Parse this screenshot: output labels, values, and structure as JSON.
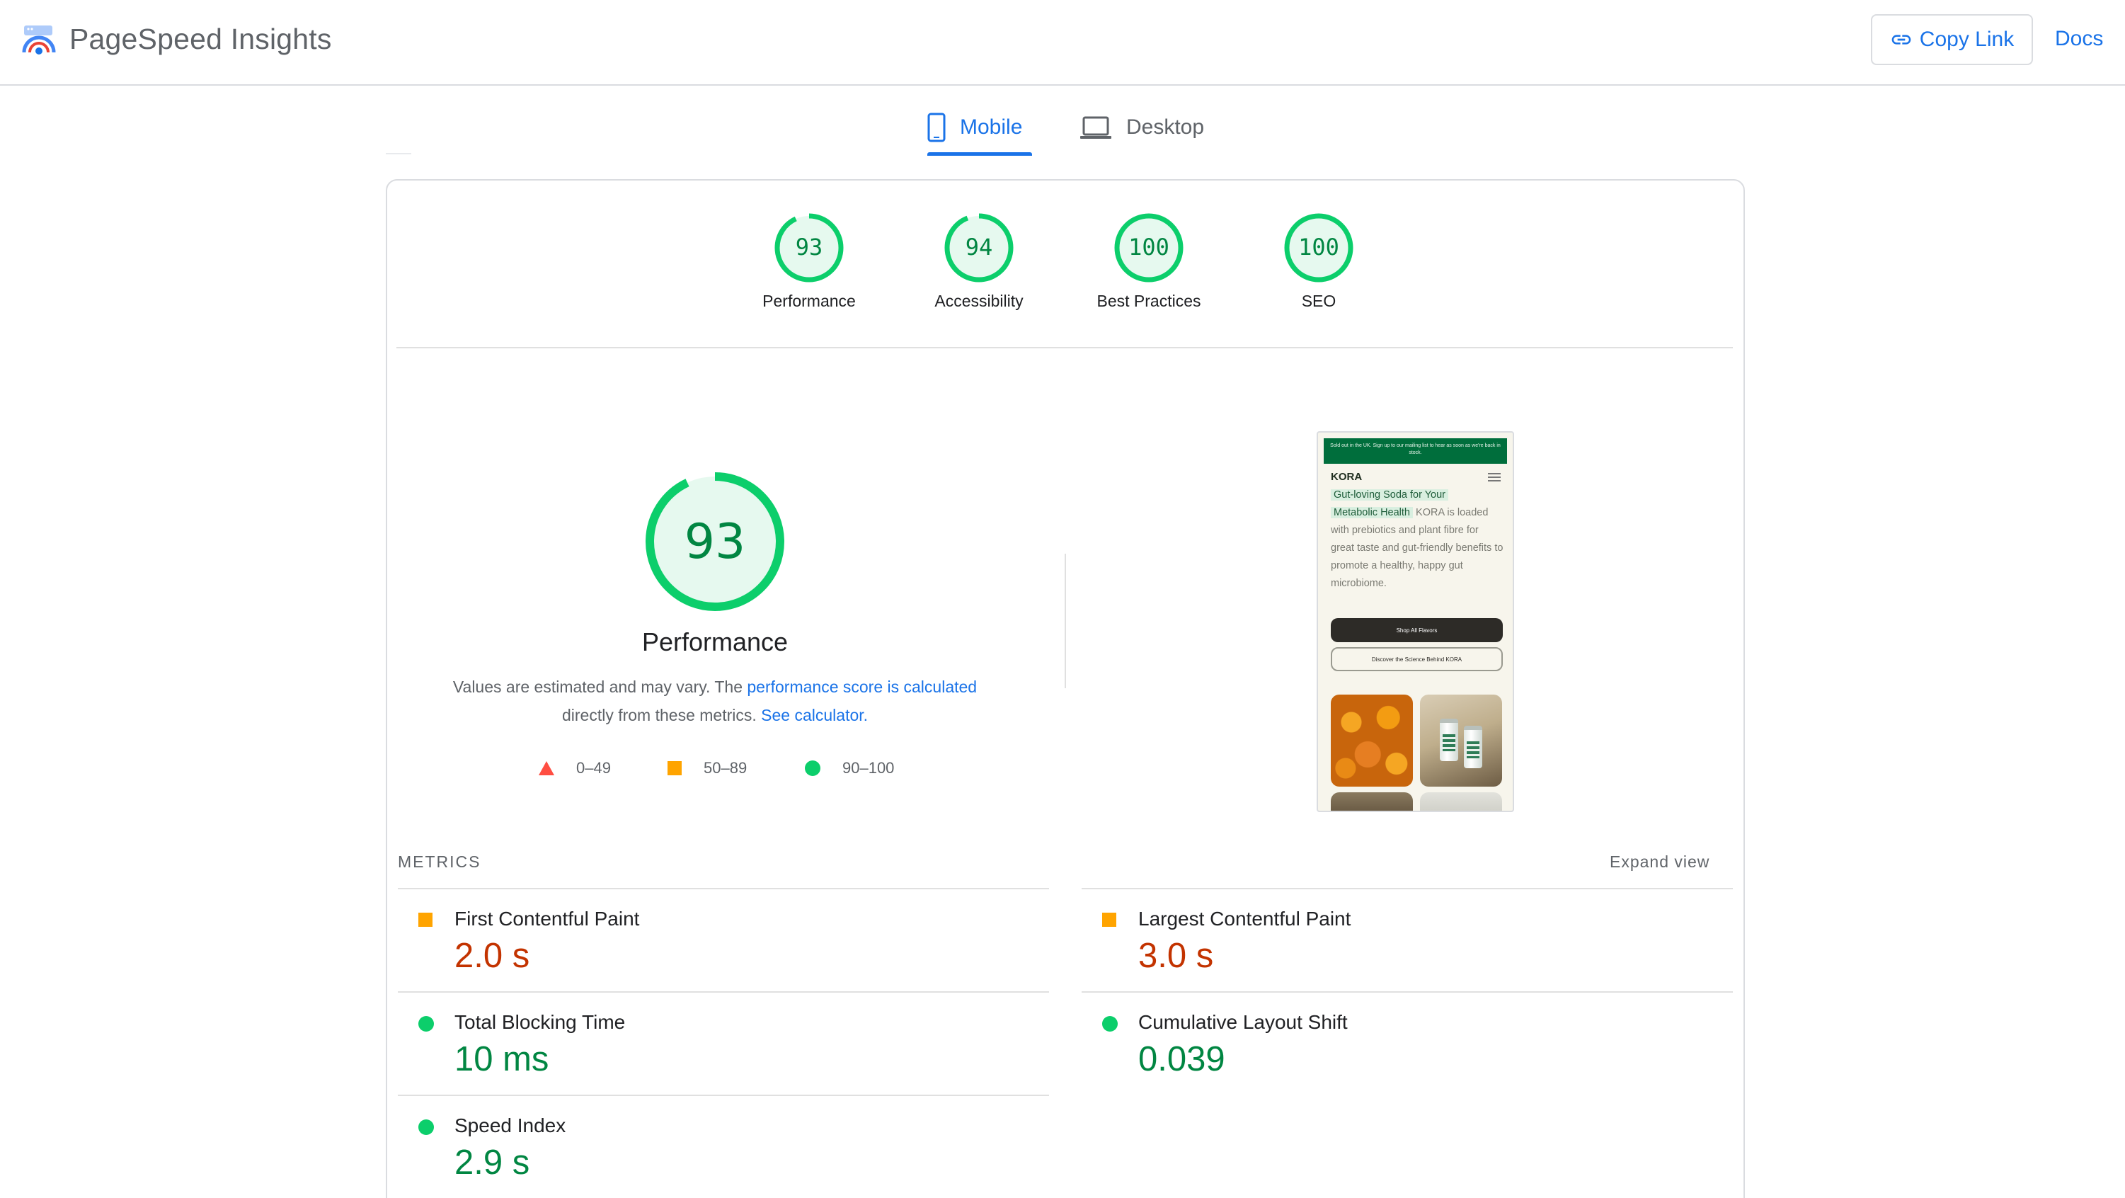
{
  "header": {
    "app_name": "PageSpeed Insights",
    "logo_icon": "pagespeed-logo-icon",
    "copy_link_label": "Copy Link",
    "docs_label": "Docs"
  },
  "tabs": [
    {
      "label": "Mobile",
      "icon": "phone-icon",
      "selected": true
    },
    {
      "label": "Desktop",
      "icon": "laptop-icon",
      "selected": false
    }
  ],
  "colors": {
    "accent": "#1a73e8",
    "pass": "#0cce6b",
    "pass_text": "#018642",
    "average": "#ffa400",
    "average_text": "#c33300",
    "fail": "#ff4e42"
  },
  "category_scores": [
    {
      "score": "93",
      "value": 93,
      "label": "Performance"
    },
    {
      "score": "94",
      "value": 94,
      "label": "Accessibility"
    },
    {
      "score": "100",
      "value": 100,
      "label": "Best Practices"
    },
    {
      "score": "100",
      "value": 100,
      "label": "SEO"
    }
  ],
  "performance": {
    "score": "93",
    "value": 93,
    "title": "Performance",
    "desc_before": "Values are estimated and may vary. The ",
    "desc_link": "performance score is calculated",
    "desc_middle": " directly from these metrics. ",
    "desc_link2": "See calculator.",
    "legend": [
      {
        "range": "0–49",
        "shape": "triangle-icon",
        "color": "#ff4e42"
      },
      {
        "range": "50–89",
        "shape": "square-icon",
        "color": "#ffa400"
      },
      {
        "range": "90–100",
        "shape": "circle-icon",
        "color": "#0cce6b"
      }
    ]
  },
  "screenshot": {
    "banner": "Sold out in the UK. Sign up to our mailing list to hear as soon as we're back in stock.",
    "logo": "KORA",
    "hero_highlight_1": "Gut-loving Soda for Your",
    "hero_highlight_2": "Metabolic Health",
    "hero_text": " KORA is loaded with prebiotics and plant fibre for great taste and gut-friendly benefits to promote a healthy, happy gut microbiome.",
    "button_primary": "Shop All Flavors",
    "button_secondary": "Discover the Science Behind KORA"
  },
  "metrics": {
    "heading": "METRICS",
    "expand_label": "Expand view",
    "items": [
      {
        "name": "First Contentful Paint",
        "value": "2.0 s",
        "rating": "average"
      },
      {
        "name": "Largest Contentful Paint",
        "value": "3.0 s",
        "rating": "average"
      },
      {
        "name": "Total Blocking Time",
        "value": "10 ms",
        "rating": "pass"
      },
      {
        "name": "Cumulative Layout Shift",
        "value": "0.039",
        "rating": "pass"
      },
      {
        "name": "Speed Index",
        "value": "2.9 s",
        "rating": "pass"
      }
    ]
  }
}
